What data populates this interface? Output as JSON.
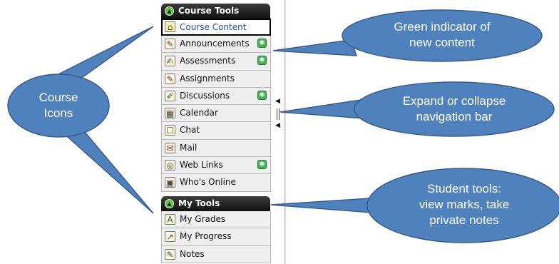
{
  "course_tools": {
    "header": "Course Tools",
    "items": [
      {
        "label": "Course Content",
        "icon": "home-icon",
        "glyph": "⌂",
        "badge": false,
        "selected": true
      },
      {
        "label": "Announcements",
        "icon": "megaphone-icon",
        "glyph": "✎",
        "badge": true,
        "selected": false
      },
      {
        "label": "Assessments",
        "icon": "assessments-icon",
        "glyph": "✍",
        "badge": true,
        "selected": false
      },
      {
        "label": "Assignments",
        "icon": "assignments-icon",
        "glyph": "✎",
        "badge": false,
        "selected": false
      },
      {
        "label": "Discussions",
        "icon": "pin-icon",
        "glyph": "✐",
        "badge": true,
        "selected": false
      },
      {
        "label": "Calendar",
        "icon": "calendar-icon",
        "glyph": "▦",
        "badge": false,
        "selected": false
      },
      {
        "label": "Chat",
        "icon": "chat-icon",
        "glyph": "☐",
        "badge": false,
        "selected": false
      },
      {
        "label": "Mail",
        "icon": "mail-icon",
        "glyph": "✉",
        "badge": false,
        "selected": false
      },
      {
        "label": "Web Links",
        "icon": "globe-icon",
        "glyph": "◎",
        "badge": true,
        "selected": false
      },
      {
        "label": "Who's Online",
        "icon": "users-icon",
        "glyph": "▣",
        "badge": false,
        "selected": false
      }
    ]
  },
  "my_tools": {
    "header": "My Tools",
    "items": [
      {
        "label": "My Grades",
        "icon": "grades-icon",
        "glyph": "A",
        "badge": false,
        "selected": false
      },
      {
        "label": "My Progress",
        "icon": "progress-icon",
        "glyph": "↗",
        "badge": false,
        "selected": false
      },
      {
        "label": "Notes",
        "icon": "notes-icon",
        "glyph": "✎",
        "badge": false,
        "selected": false
      }
    ]
  },
  "new_badge_glyph": "✱",
  "callouts": {
    "course_icons": [
      "Course",
      "Icons"
    ],
    "green_indicator": [
      "Green indicator of",
      "new content"
    ],
    "expand_collapse": [
      "Expand or collapse",
      "navigation bar"
    ],
    "student_tools": [
      "Student tools:",
      "view marks, take",
      "private notes"
    ]
  },
  "colors": {
    "callout_fill": "#4f81bd",
    "callout_stroke": "#385d8a",
    "header_bg": "#1a1a1a",
    "badge_green": "#3fb34f"
  }
}
